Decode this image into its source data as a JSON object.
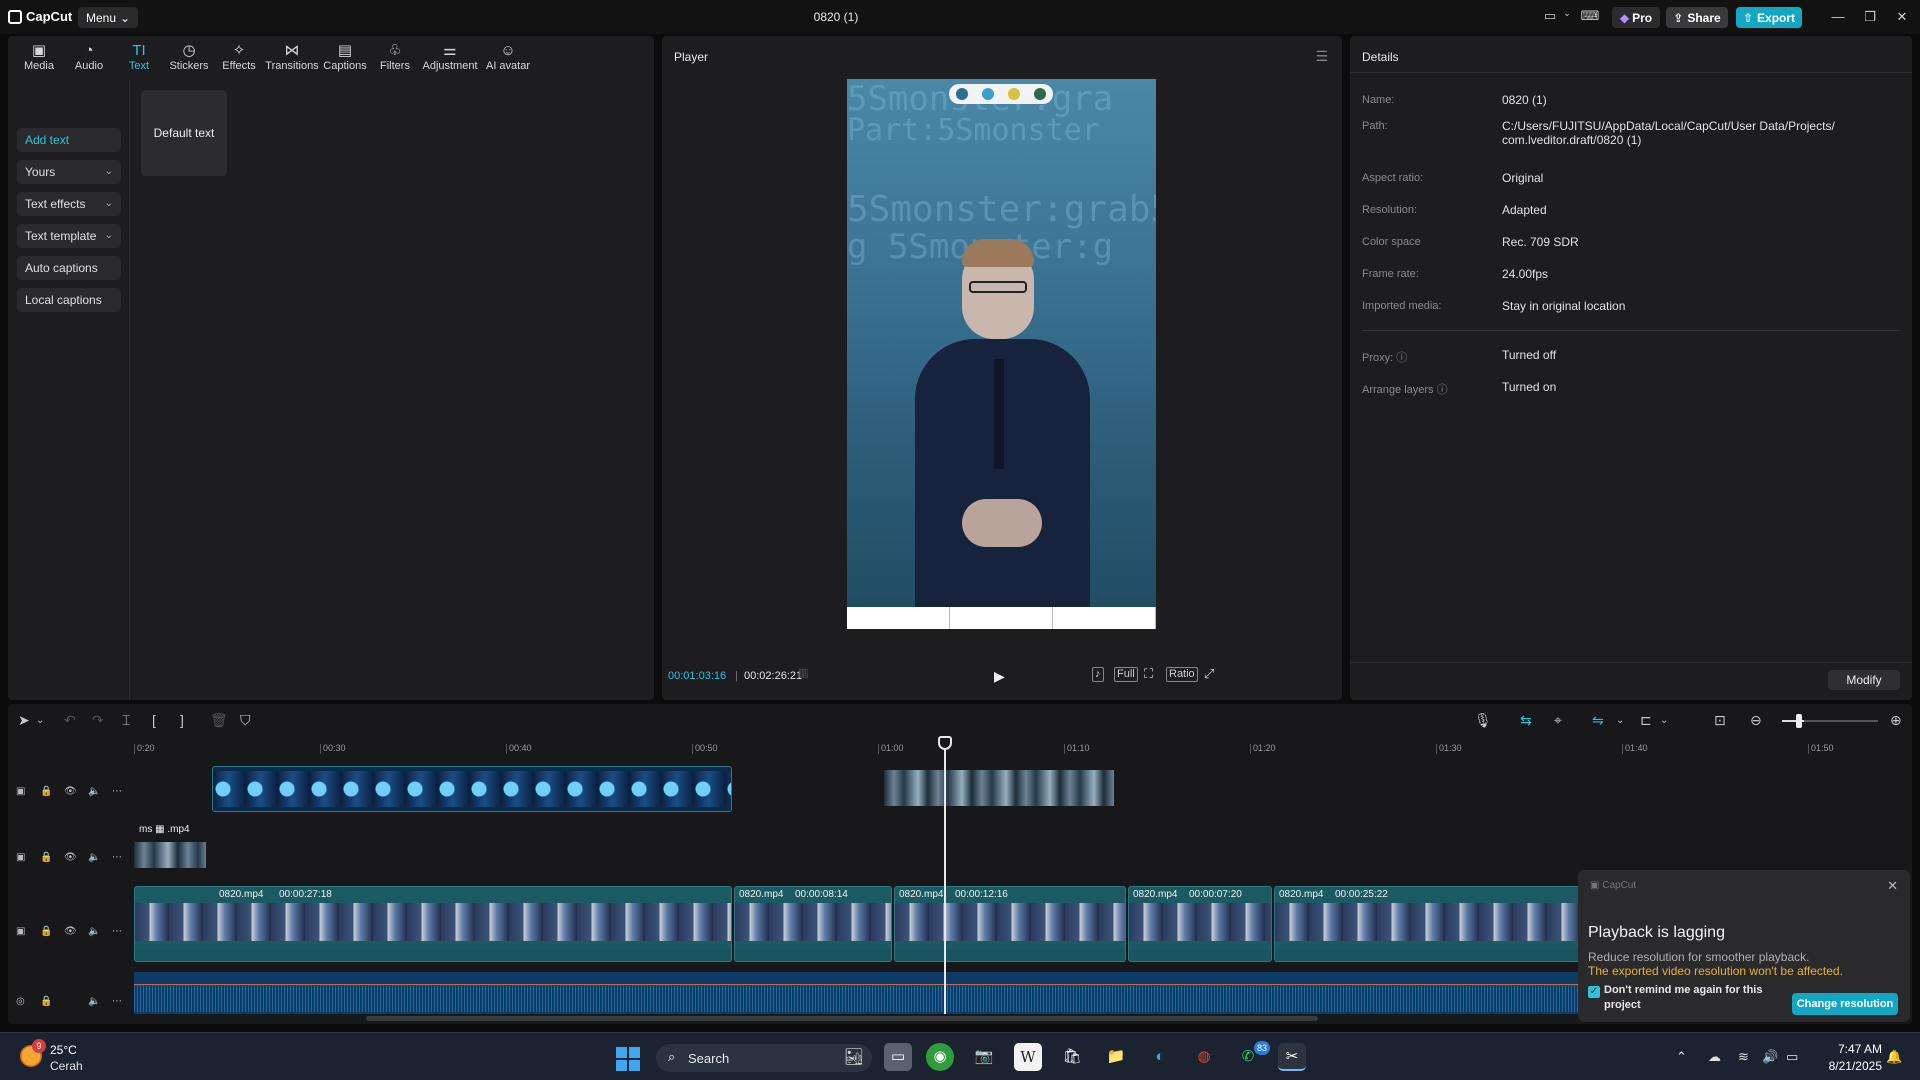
{
  "titlebar": {
    "app_name": "CapCut",
    "menu_label": "Menu",
    "project_title": "0820 (1)",
    "pro_label": "Pro",
    "share_label": "Share",
    "export_label": "Export"
  },
  "toolbar_tabs": [
    {
      "label": "Media",
      "icon": "media-icon"
    },
    {
      "label": "Audio",
      "icon": "audio-icon"
    },
    {
      "label": "Text",
      "icon": "text-icon",
      "active": true
    },
    {
      "label": "Stickers",
      "icon": "stickers-icon"
    },
    {
      "label": "Effects",
      "icon": "effects-icon"
    },
    {
      "label": "Transitions",
      "icon": "transitions-icon"
    },
    {
      "label": "Captions",
      "icon": "captions-icon"
    },
    {
      "label": "Filters",
      "icon": "filters-icon"
    },
    {
      "label": "Adjustment",
      "icon": "adjustment-icon"
    },
    {
      "label": "AI avatar",
      "icon": "ai-avatar-icon"
    }
  ],
  "text_sidebar": {
    "add_text": "Add text",
    "yours": "Yours",
    "text_effects": "Text effects",
    "text_template": "Text template",
    "auto_captions": "Auto captions",
    "local_captions": "Local captions"
  },
  "default_text_card": "Default text",
  "player": {
    "title": "Player",
    "current_time": "00:01:03:16",
    "total_time": "00:02:26:21",
    "full_label": "Full",
    "ratio_label": "Ratio"
  },
  "details": {
    "title": "Details",
    "rows": {
      "name": {
        "label": "Name:",
        "value": "0820 (1)"
      },
      "path": {
        "label": "Path:",
        "value": "C:/Users/FUJITSU/AppData/Local/CapCut/User Data/Projects/ com.lveditor.draft/0820 (1)"
      },
      "aspect": {
        "label": "Aspect ratio:",
        "value": "Original"
      },
      "resolution": {
        "label": "Resolution:",
        "value": "Adapted"
      },
      "color_space": {
        "label": "Color space",
        "value": "Rec. 709 SDR"
      },
      "frame_rate": {
        "label": "Frame rate:",
        "value": "24.00fps"
      },
      "imported_media": {
        "label": "Imported media:",
        "value": "Stay in original location"
      },
      "proxy": {
        "label": "Proxy:",
        "value": "Turned off"
      },
      "arrange_layers": {
        "label": "Arrange layers",
        "value": "Turned on"
      }
    },
    "modify_label": "Modify"
  },
  "timeline": {
    "ruler_ticks": [
      "0:20",
      "00:30",
      "00:40",
      "00:50",
      "01:00",
      "01:10",
      "01:20",
      "01:30",
      "01:40",
      "01:50"
    ],
    "overlay_clip_label": "ms",
    "overlay_clip_ext": ".mp4",
    "main_clips": [
      {
        "name": "0820.mp4",
        "duration": "00:00:27:18"
      },
      {
        "name": "0820.mp4",
        "duration": "00:00:08:14"
      },
      {
        "name": "0820.mp4",
        "duration": "00:00:12:16"
      },
      {
        "name": "0820.mp4",
        "duration": "00:00:07:20"
      },
      {
        "name": "0820.mp4",
        "duration": "00:00:25:22"
      }
    ]
  },
  "toast": {
    "brand": "CapCut",
    "title": "Playback is lagging",
    "description": "Reduce resolution for smoother playback.",
    "warning": "The exported video resolution won't be affected.",
    "checkbox_label": "Don't remind me again for this project",
    "button_label": "Change resolution",
    "warning_color": "#e6b23a"
  },
  "taskbar": {
    "weather_badge": "9",
    "weather_temp": "25°C",
    "weather_desc": "Cerah",
    "search_label": "Search",
    "whatsapp_badge": "83",
    "time": "7:47 AM",
    "date": "8/21/2025"
  },
  "colors": {
    "accent": "#14a7c4",
    "active_tab": "#2bc4e0"
  }
}
